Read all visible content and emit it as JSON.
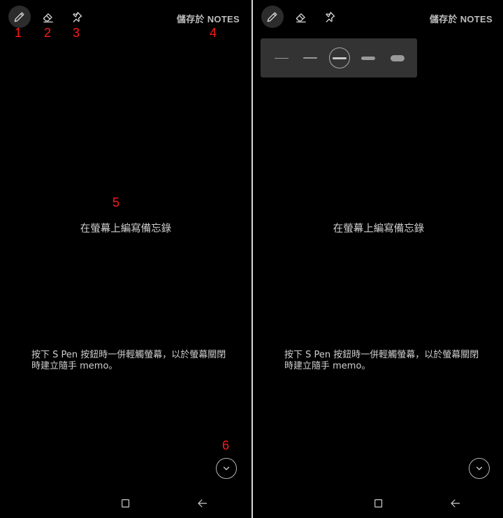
{
  "toolbar": {
    "tools": [
      {
        "name": "pen",
        "icon": "pen-icon",
        "active": true
      },
      {
        "name": "eraser",
        "icon": "eraser-icon",
        "active": false
      },
      {
        "name": "pin",
        "icon": "pin-icon",
        "active": false
      }
    ],
    "save_label": "儲存於 NOTES"
  },
  "markers": [
    "1",
    "2",
    "3",
    "4",
    "5",
    "6"
  ],
  "main": {
    "title": "在螢幕上編寫備忘錄",
    "body_line1": "按下 S Pen 按鈕時一併輕觸螢幕，以於螢幕關閉",
    "body_line2": "時建立隨手 memo。"
  },
  "pen_thickness": {
    "options": [
      1,
      2,
      3,
      4,
      5
    ],
    "selected": 3
  },
  "icons": {
    "collapse": "chevron-down-icon",
    "nav_recent": "recent-apps-icon",
    "nav_back": "back-arrow-icon"
  },
  "colors": {
    "background": "#000000",
    "marker": "#ff1a1a",
    "panel": "#333333"
  }
}
